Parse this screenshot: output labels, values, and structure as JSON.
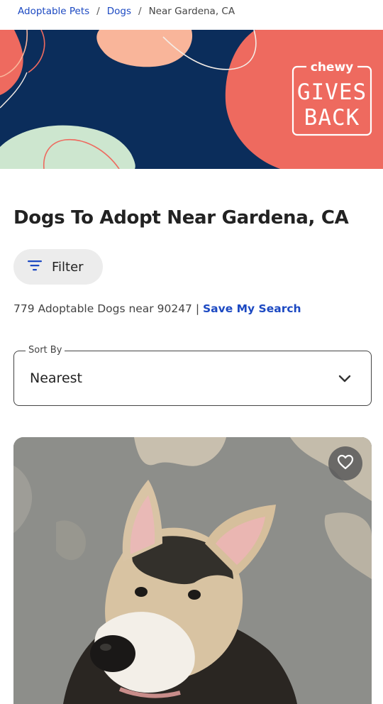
{
  "breadcrumb": {
    "items": [
      "Adoptable Pets",
      "Dogs"
    ],
    "separator": "/",
    "current": "Near Gardena, CA"
  },
  "banner": {
    "logo_top": "chewy",
    "logo_line1": "GIVES",
    "logo_line2": "BACK",
    "colors": {
      "navy": "#0b2d5b",
      "coral": "#ee6a5f",
      "peach": "#f9b59a",
      "mint": "#cde6cf"
    }
  },
  "page": {
    "title": "Dogs To Adopt Near Gardena, CA"
  },
  "filter": {
    "label": "Filter",
    "icon": "filter-icon"
  },
  "results": {
    "text": "779 Adoptable Dogs near 90247 |",
    "save_link": "Save My Search"
  },
  "sort": {
    "legend": "Sort By",
    "selected": "Nearest",
    "icon": "chevron-down-icon"
  },
  "pet_card": {
    "favorite_icon": "heart-icon"
  },
  "colors": {
    "link": "#1c49c2",
    "text": "#222222"
  }
}
